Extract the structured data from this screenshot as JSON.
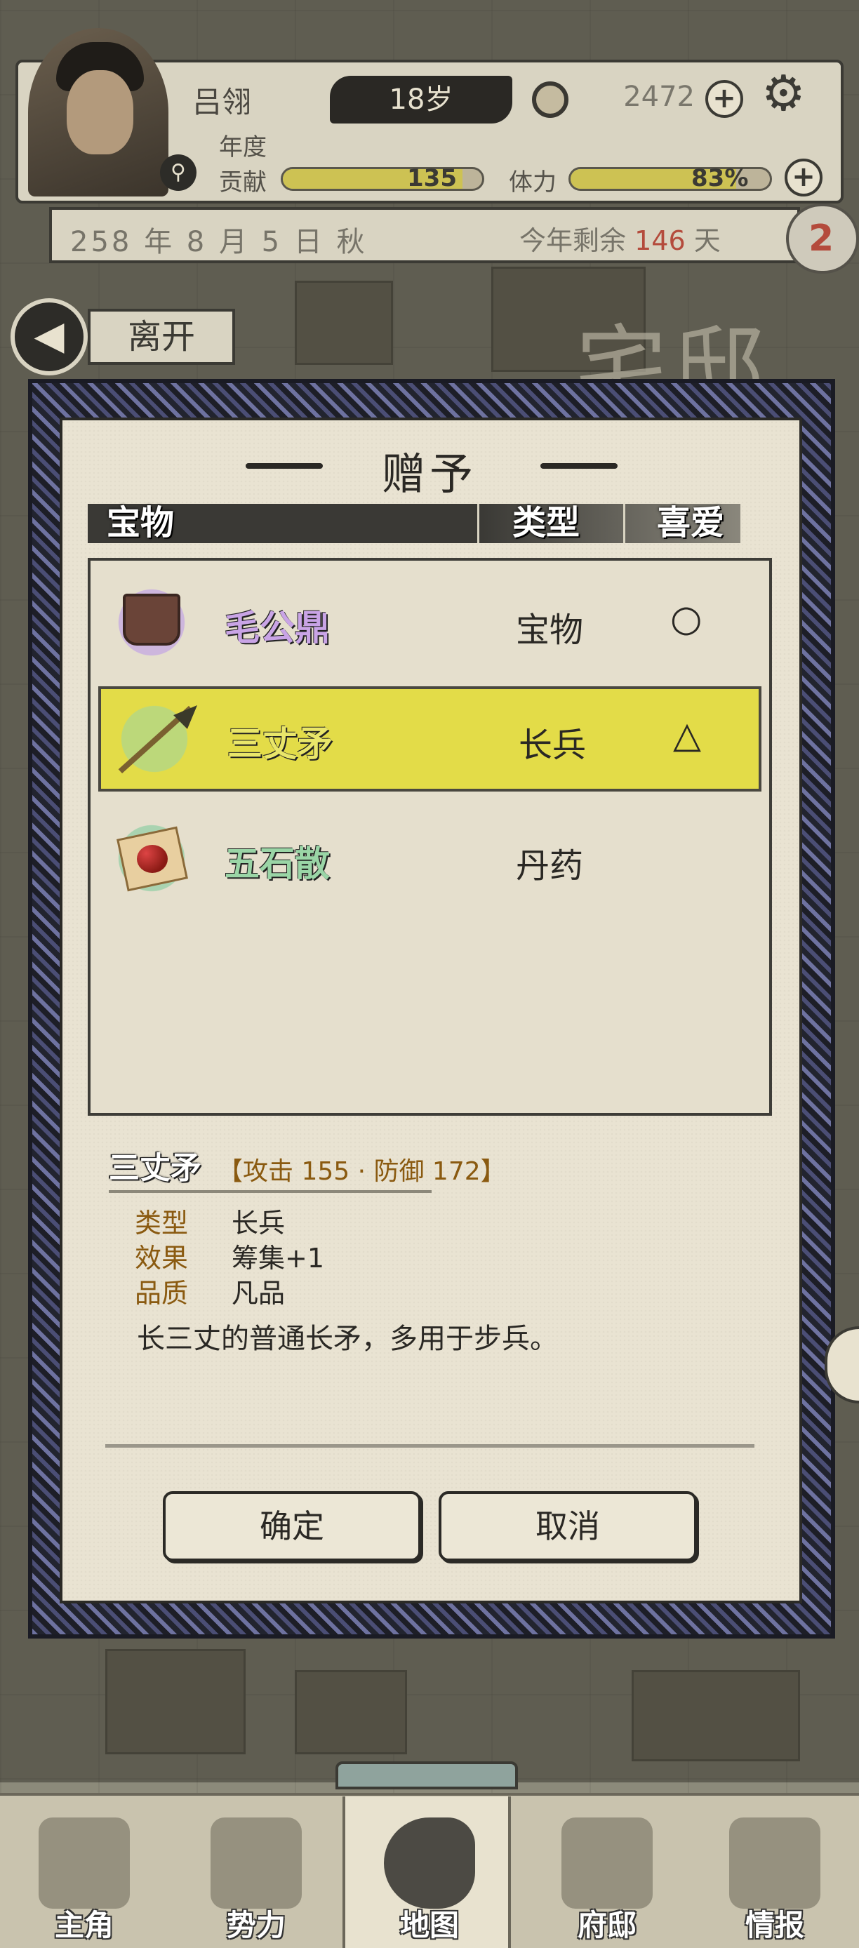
{
  "header": {
    "player_name": "吕翎",
    "age": "18岁",
    "coins": "2472",
    "contribution_label": "年度\n贡献",
    "contribution_label_1": "年度",
    "contribution_label_2": "贡献",
    "contribution_value": "135",
    "contribution_progress": 0.9,
    "stamina_label": "体力",
    "stamina_value": "83%",
    "stamina_progress": 0.83
  },
  "date": {
    "text": "258 年 8 月 5 日 秋",
    "remain_prefix": "今年剩余",
    "remain_days": "146",
    "remain_suffix": "天"
  },
  "notification_count": "2",
  "leave_label": "离开",
  "location_title": "宅邸",
  "dialog": {
    "title": "赠予",
    "columns": [
      "宝物",
      "类型",
      "喜爱"
    ],
    "items": [
      {
        "name": "毛公鼎",
        "type": "宝物",
        "like": "○",
        "name_color": "#c9a4e6",
        "icon": "ding-cauldron-icon",
        "selected": false
      },
      {
        "name": "三丈矛",
        "type": "长兵",
        "like": "△",
        "name_color": "#e9e66a",
        "icon": "spear-icon",
        "selected": true
      },
      {
        "name": "五石散",
        "type": "丹药",
        "like": "",
        "name_color": "#9ad5a6",
        "icon": "medicine-pills-icon",
        "selected": false
      }
    ],
    "detail": {
      "name": "三丈矛",
      "stats": "【攻击 155 · 防御 172】",
      "rows": [
        {
          "key": "类型",
          "value": "长兵"
        },
        {
          "key": "效果",
          "value": "筹集+1"
        },
        {
          "key": "品质",
          "value": "凡品"
        }
      ],
      "description": "长三丈的普通长矛，多用于步兵。"
    },
    "confirm_label": "确定",
    "cancel_label": "取消"
  },
  "nav": [
    {
      "label": "主角",
      "icon": "hero-icon"
    },
    {
      "label": "势力",
      "icon": "faction-flag-icon"
    },
    {
      "label": "地图",
      "icon": "map-icon",
      "active": true
    },
    {
      "label": "府邸",
      "icon": "mansion-icon"
    },
    {
      "label": "情报",
      "icon": "intel-scroll-icon"
    }
  ],
  "colors": {
    "selected_row": "#e3dc48",
    "accent_red": "#b44b3c",
    "paper": "#e9e3d2"
  }
}
